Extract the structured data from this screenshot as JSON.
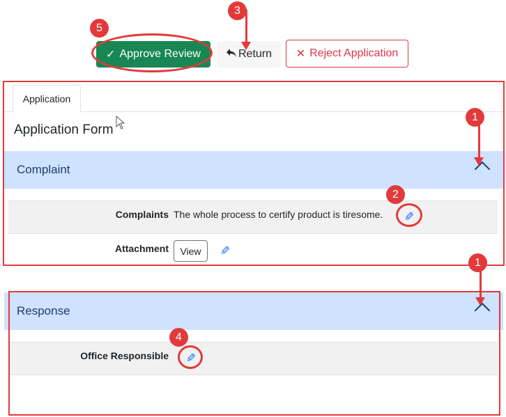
{
  "toolbar": {
    "approve_label": "Approve Review",
    "approve_icon": "check-icon",
    "return_label": "Return",
    "return_icon": "reply-arrow-icon",
    "reject_label": "Reject Application",
    "reject_icon": "x-icon"
  },
  "tabs": [
    {
      "label": "Application",
      "active": true
    }
  ],
  "form": {
    "title": "Application Form",
    "sections": [
      {
        "header": "Complaint",
        "expanded": true,
        "fields": [
          {
            "label": "Complaints",
            "value": "The whole process to certify product is tiresome.",
            "editable": true
          },
          {
            "label": "Attachment",
            "button_label": "View",
            "editable": true
          }
        ]
      },
      {
        "header": "Response",
        "expanded": true,
        "fields": [
          {
            "label": "Office Responsible",
            "value": "",
            "editable": true
          }
        ]
      }
    ]
  },
  "annotations": {
    "callouts": [
      "1",
      "2",
      "3",
      "4",
      "5",
      "1"
    ],
    "color": "#e23a3a"
  },
  "colors": {
    "approve": "#198754",
    "reject": "#dc3545",
    "accordion_header": "#cfe2ff",
    "edit_icon": "#0d6efd"
  }
}
